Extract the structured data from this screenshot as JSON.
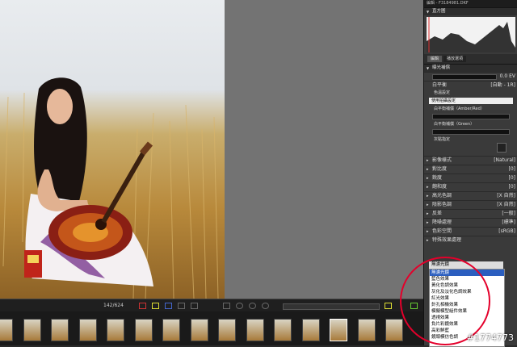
{
  "panel": {
    "title": "編輯 - F3184981.DKF",
    "histogram_label": "直方圖",
    "tabs": [
      "編輯",
      "播放選項"
    ],
    "exposure_section": "曝光補償",
    "exposure_value": "0.0 EV",
    "wb_label": "白平衡",
    "wb_value": "[自動 - 1R]",
    "color_temp_label": "色溫設定",
    "color_temp_dropdown": "使用拍攝設定",
    "wb_amber_label": "白平衡補償（Amber/Red）",
    "wb_green_label": "白平衡補償（Green）",
    "grey_point_label": "灰點指定",
    "rows": [
      {
        "label": "影像樣式",
        "value": "[Natural]"
      },
      {
        "label": "對比度",
        "value": "[0]"
      },
      {
        "label": "銳度",
        "value": "[0]"
      },
      {
        "label": "飽和度",
        "value": "[0]"
      },
      {
        "label": "高光色調",
        "value": "[X 自然]"
      },
      {
        "label": "陰影色調",
        "value": "[X 自然]"
      },
      {
        "label": "反差",
        "value": "[一般]"
      },
      {
        "label": "降噪處理",
        "value": "[標準]"
      },
      {
        "label": "色彩空間",
        "value": "[sRGB]"
      },
      {
        "label": "特殊效果處理",
        "value": ""
      }
    ],
    "effect_dropdown": "無濾光鏡",
    "effect_options": [
      "無濾光鏡",
      "藍色效果",
      "黃化色調效果",
      "灰化及淡化色調效果",
      "紅光效果",
      "針孔相機效果",
      "模擬模型組件效果",
      "透視效果",
      "負片彩鏡效果",
      "高彩鮮藍",
      "鏡頭模仿色調"
    ],
    "effect_selected_index": 0
  },
  "toolbar": {
    "counter": "142/624"
  },
  "filmstrip": {
    "thumb_count": 15,
    "active_index": 12
  },
  "watermark": "#1774773",
  "colors": {
    "highlight_circle": "#e4002b",
    "selection": "#2b5ebf"
  }
}
